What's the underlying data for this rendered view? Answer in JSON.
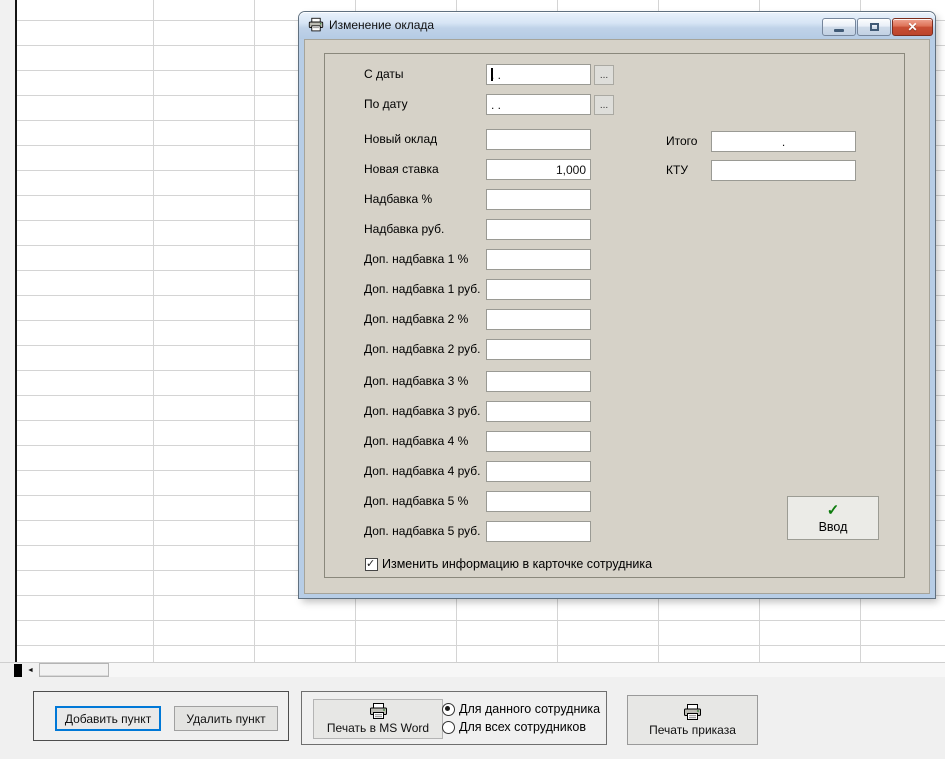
{
  "window": {
    "title": "Изменение оклада",
    "controls": {
      "minimize": "Свернуть",
      "maximize": "Развернуть",
      "close": "Закрыть"
    }
  },
  "dialog": {
    "rows": [
      {
        "label": "С даты",
        "value": ". .",
        "browse": "...",
        "caret": true
      },
      {
        "label": "По дату",
        "value": ". .",
        "browse": "..."
      },
      {
        "label": "Новый оклад",
        "value": ""
      },
      {
        "label": "Новая ставка",
        "value": "1,000",
        "align": "right"
      },
      {
        "label": "Надбавка %",
        "value": ""
      },
      {
        "label": "Надбавка руб.",
        "value": ""
      },
      {
        "label": "Доп. надбавка 1 %",
        "value": ""
      },
      {
        "label": "Доп. надбавка 1 руб.",
        "value": ""
      },
      {
        "label": "Доп. надбавка 2 %",
        "value": ""
      },
      {
        "label": "Доп. надбавка 2 руб.",
        "value": ""
      },
      {
        "label": "Доп. надбавка 3 %",
        "value": ""
      },
      {
        "label": "Доп. надбавка 3 руб.",
        "value": ""
      },
      {
        "label": "Доп. надбавка 4 %",
        "value": ""
      },
      {
        "label": "Доп. надбавка 4 руб.",
        "value": ""
      },
      {
        "label": "Доп. надбавка 5 %",
        "value": ""
      },
      {
        "label": "Доп. надбавка 5 руб.",
        "value": ""
      }
    ],
    "right_rows": [
      {
        "label": "Итого",
        "value": "."
      },
      {
        "label": "КТУ",
        "value": ""
      }
    ],
    "enter_button": {
      "label": "Ввод",
      "icon": "green-check"
    },
    "checkbox": {
      "label": "Изменить информацию в карточке сотрудника",
      "checked": true
    }
  },
  "bottom_bar": {
    "add_button": "Добавить пункт",
    "delete_button": "Удалить пункт",
    "print_word_button": "Печать в MS Word",
    "print_scope_radios": [
      {
        "label": "Для данного сотрудника",
        "selected": true
      },
      {
        "label": "Для всех сотрудников",
        "selected": false
      }
    ],
    "print_order_button": "Печать приказа",
    "scroll_left_arrow": "◄"
  },
  "colors": {
    "client_gray": "#d6d2c8",
    "titlebar_blue": "#bfd2e8",
    "close_red": "#c94f35",
    "focus_blue": "#0078d7",
    "check_green": "#0e7c0e"
  }
}
